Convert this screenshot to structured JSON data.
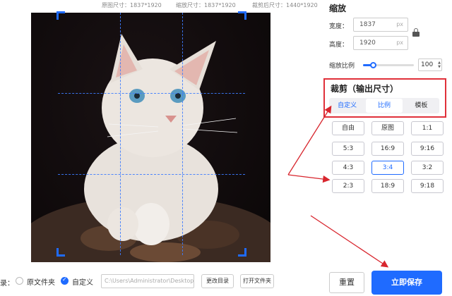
{
  "top_info": {
    "original_size": "原图尺寸：1837*1920",
    "scaled_size": "缩放尺寸：1837*1920",
    "cropped_size": "裁剪后尺寸：1440*1920"
  },
  "output": {
    "label": "录：",
    "option_original": "原文件夹",
    "option_custom": "自定义",
    "path_value": "C:\\Users\\Administrator\\Desktop\\",
    "change_dir": "更改目录",
    "open_folder": "打开文件夹"
  },
  "zoom": {
    "title": "缩放",
    "width_label": "宽度：",
    "width_value": "1837",
    "height_label": "高度：",
    "height_value": "1920",
    "unit": "px",
    "scale_label": "缩放比例",
    "scale_value": "100",
    "scale_fraction": 0.2
  },
  "crop": {
    "title": "裁剪（输出尺寸）",
    "tabs": [
      "自定义",
      "比例",
      "模板"
    ],
    "active_tab": "比例",
    "ratios": [
      "自由",
      "原图",
      "1:1",
      "5:3",
      "16:9",
      "9:16",
      "4:3",
      "3:4",
      "3:2",
      "2:3",
      "18:9",
      "9:18"
    ],
    "selected_ratio": "3:4"
  },
  "actions": {
    "reset": "重置",
    "save": "立即保存"
  },
  "colors": {
    "accent": "#1f6bff",
    "highlight_box": "#e0303a"
  }
}
